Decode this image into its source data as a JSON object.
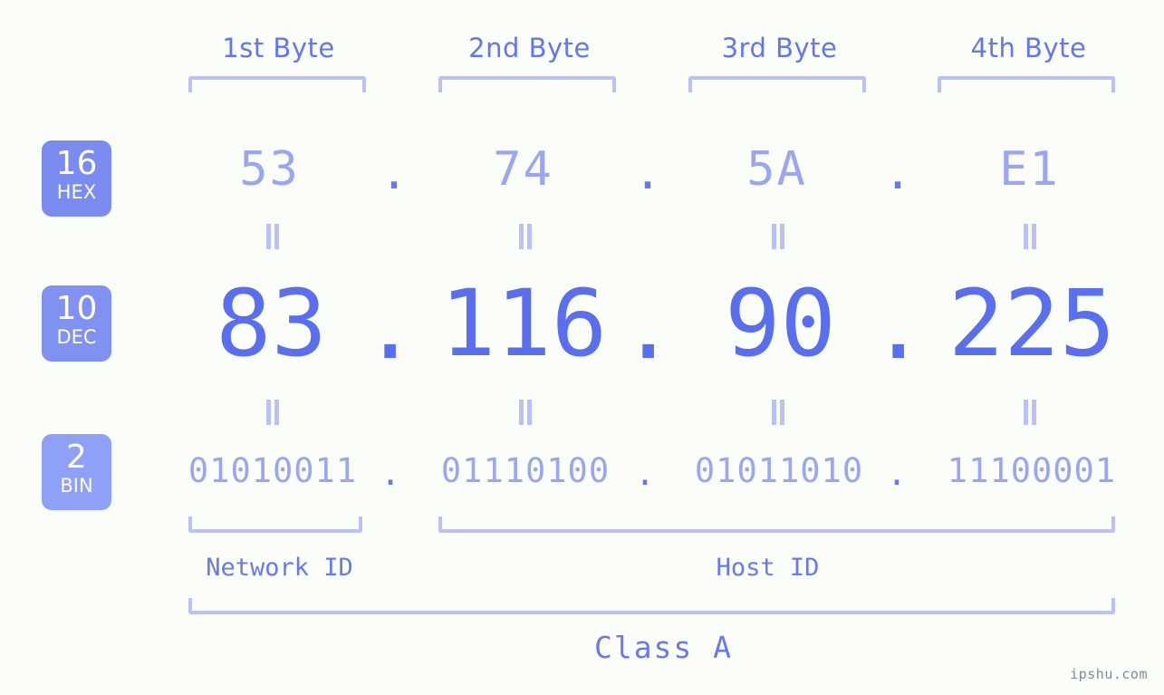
{
  "watermark": "ipshu.com",
  "colors": {
    "background": "#fbfdf8",
    "accent_strong": "#5a6ef0",
    "accent_mid": "#6375ef",
    "accent_light": "#9aa6f2",
    "bracket": "#b9c1f7",
    "badge_hex": "#7b8cf0",
    "badge_dec": "#8091f2",
    "badge_bin": "#8fa0f7",
    "watermark": "#7c8b99"
  },
  "byte_headers": [
    {
      "label": "1st Byte"
    },
    {
      "label": "2nd Byte"
    },
    {
      "label": "3rd Byte"
    },
    {
      "label": "4th Byte"
    }
  ],
  "radix_badges": [
    {
      "num": "16",
      "unit": "HEX"
    },
    {
      "num": "10",
      "unit": "DEC"
    },
    {
      "num": "2",
      "unit": "BIN"
    }
  ],
  "separator": ".",
  "equals_glyph": "॥",
  "rows": {
    "hex": {
      "radix": "16",
      "unit": "HEX",
      "values": [
        "53",
        "74",
        "5A",
        "E1"
      ]
    },
    "dec": {
      "radix": "10",
      "unit": "DEC",
      "values": [
        "83",
        "116",
        "90",
        "225"
      ]
    },
    "bin": {
      "radix": "2",
      "unit": "BIN",
      "values": [
        "01010011",
        "01110100",
        "01011010",
        "11100001"
      ]
    }
  },
  "address": {
    "hex": "53.74.5A.E1",
    "dec": "83.116.90.225",
    "bin": "01010011.01110100.01011010.11100001"
  },
  "segments": {
    "network_id": "Network ID",
    "host_id": "Host ID",
    "class": "Class A"
  }
}
